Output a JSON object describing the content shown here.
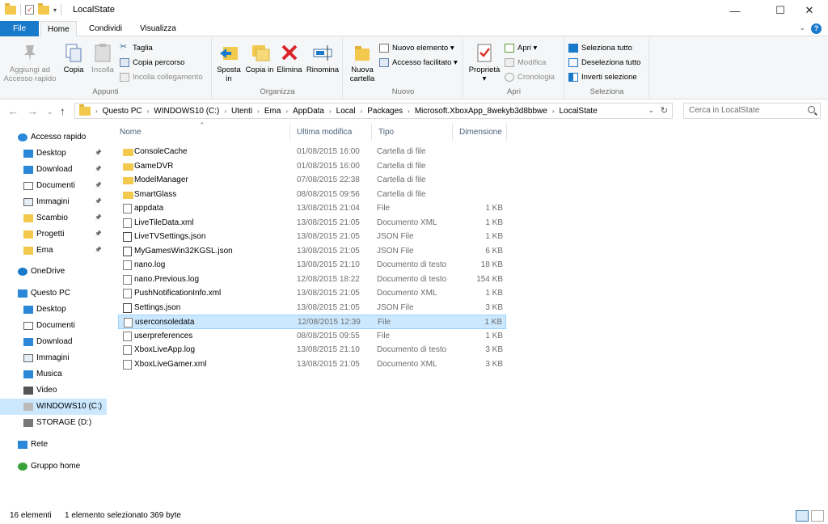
{
  "window": {
    "title": "LocalState",
    "minimize": "—",
    "maximize": "☐",
    "close": "✕"
  },
  "tabs": {
    "file": "File",
    "home": "Home",
    "share": "Condividi",
    "view": "Visualizza",
    "help": "?"
  },
  "ribbon": {
    "clipboard": {
      "pin": "Aggiungi ad Accesso rapido",
      "copy": "Copia",
      "paste": "Incolla",
      "cut": "Taglia",
      "copy_path": "Copia percorso",
      "paste_link": "Incolla collegamento",
      "label": "Appunti"
    },
    "organize": {
      "move": "Sposta in",
      "copy_to": "Copia in",
      "delete": "Elimina",
      "rename": "Rinomina",
      "label": "Organizza"
    },
    "new": {
      "new_folder": "Nuova cartella",
      "new_item": "Nuovo elemento",
      "easy_access": "Accesso facilitato",
      "label": "Nuovo"
    },
    "open": {
      "properties": "Proprietà",
      "open": "Apri",
      "edit": "Modifica",
      "history": "Cronologia",
      "label": "Apri"
    },
    "select": {
      "select_all": "Seleziona tutto",
      "select_none": "Deseleziona tutto",
      "invert": "Inverti selezione",
      "label": "Seleziona"
    }
  },
  "address": {
    "crumbs": [
      "Questo PC",
      "WINDOWS10 (C:)",
      "Utenti",
      "Ema",
      "AppData",
      "Local",
      "Packages",
      "Microsoft.XboxApp_8wekyb3d8bbwe",
      "LocalState"
    ],
    "search_placeholder": "Cerca in LocalState"
  },
  "nav": {
    "quick_access": "Accesso rapido",
    "quick_items": [
      "Desktop",
      "Download",
      "Documenti",
      "Immagini",
      "Scambio",
      "Progetti",
      "Ema"
    ],
    "onedrive": "OneDrive",
    "this_pc": "Questo PC",
    "pc_items": [
      "Desktop",
      "Documenti",
      "Download",
      "Immagini",
      "Musica",
      "Video",
      "WINDOWS10 (C:)",
      "STORAGE (D:)"
    ],
    "network": "Rete",
    "homegroup": "Gruppo home"
  },
  "columns": {
    "name": "Nome",
    "modified": "Ultima modifica",
    "type": "Tipo",
    "size": "Dimensione"
  },
  "files": [
    {
      "name": "ConsoleCache",
      "modified": "01/08/2015 16:00",
      "type": "Cartella di file",
      "size": "",
      "icon": "folder"
    },
    {
      "name": "GameDVR",
      "modified": "01/08/2015 16:00",
      "type": "Cartella di file",
      "size": "",
      "icon": "folder"
    },
    {
      "name": "ModelManager",
      "modified": "07/08/2015 22:38",
      "type": "Cartella di file",
      "size": "",
      "icon": "folder"
    },
    {
      "name": "SmartGlass",
      "modified": "08/08/2015 09:56",
      "type": "Cartella di file",
      "size": "",
      "icon": "folder"
    },
    {
      "name": "appdata",
      "modified": "13/08/2015 21:04",
      "type": "File",
      "size": "1 KB",
      "icon": "file"
    },
    {
      "name": "LiveTileData.xml",
      "modified": "13/08/2015 21:05",
      "type": "Documento XML",
      "size": "1 KB",
      "icon": "file"
    },
    {
      "name": "LiveTVSettings.json",
      "modified": "13/08/2015 21:05",
      "type": "JSON File",
      "size": "1 KB",
      "icon": "json"
    },
    {
      "name": "MyGamesWin32KGSL.json",
      "modified": "13/08/2015 21:05",
      "type": "JSON File",
      "size": "6 KB",
      "icon": "json"
    },
    {
      "name": "nano.log",
      "modified": "13/08/2015 21:10",
      "type": "Documento di testo",
      "size": "18 KB",
      "icon": "file"
    },
    {
      "name": "nano.Previous.log",
      "modified": "12/08/2015 18:22",
      "type": "Documento di testo",
      "size": "154 KB",
      "icon": "file"
    },
    {
      "name": "PushNotificationInfo.xml",
      "modified": "13/08/2015 21:05",
      "type": "Documento XML",
      "size": "1 KB",
      "icon": "file"
    },
    {
      "name": "Settings.json",
      "modified": "13/08/2015 21:05",
      "type": "JSON File",
      "size": "3 KB",
      "icon": "json"
    },
    {
      "name": "userconsoledata",
      "modified": "12/08/2015 12:39",
      "type": "File",
      "size": "1 KB",
      "icon": "file",
      "selected": true
    },
    {
      "name": "userpreferences",
      "modified": "08/08/2015 09:55",
      "type": "File",
      "size": "1 KB",
      "icon": "file"
    },
    {
      "name": "XboxLiveApp.log",
      "modified": "13/08/2015 21:10",
      "type": "Documento di testo",
      "size": "3 KB",
      "icon": "file"
    },
    {
      "name": "XboxLiveGamer.xml",
      "modified": "13/08/2015 21:05",
      "type": "Documento XML",
      "size": "3 KB",
      "icon": "file"
    }
  ],
  "status": {
    "count": "16 elementi",
    "selection": "1 elemento selezionato  369 byte"
  },
  "colors": {
    "accent": "#1979ca",
    "selection": "#cce8ff",
    "folder": "#f2c94c"
  }
}
